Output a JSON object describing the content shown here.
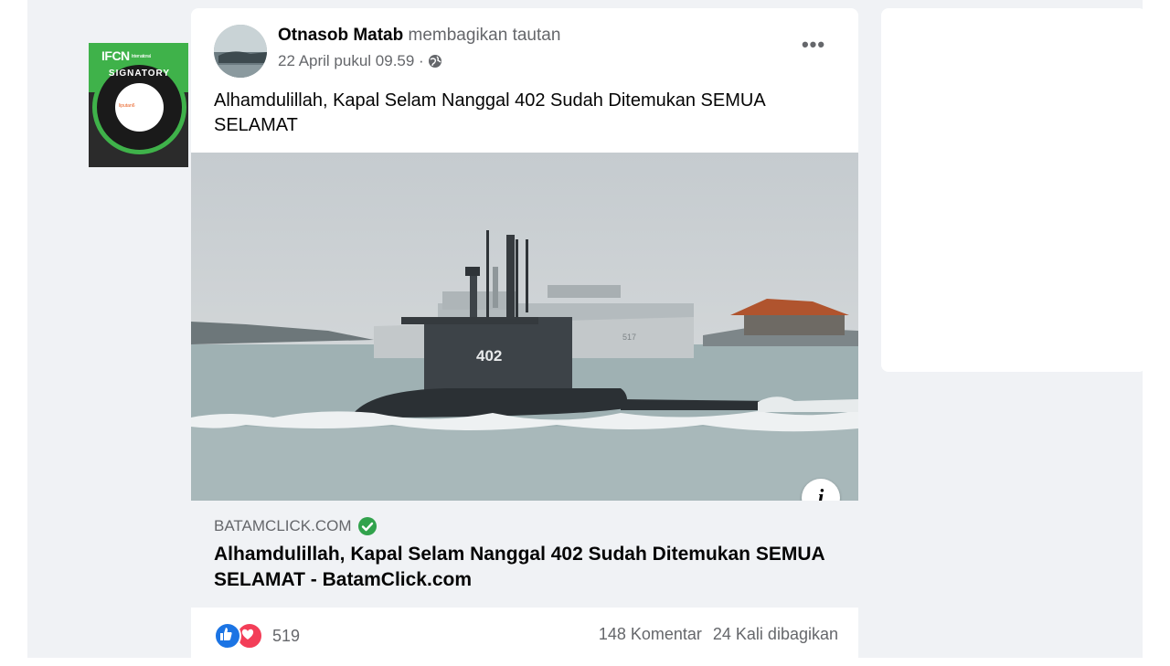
{
  "badge": {
    "top": "IFCN",
    "top_small": "International",
    "ring": "SIGNATORY",
    "inner": "liputan6"
  },
  "post": {
    "author": "Otnasob Matab",
    "action": "membagikan tautan",
    "timestamp": "22 April pukul 09.59 ·",
    "privacy_icon": "globe-icon",
    "more_label": "•••",
    "caption": "Alhamdulillah, Kapal Selam Nanggal 402 Sudah Ditemukan SEMUA SELAMAT",
    "image": {
      "hull_number": "402",
      "ship_number": "517"
    },
    "info_label": "i",
    "link": {
      "domain": "BATAMCLICK.COM",
      "title": "Alhamdulillah, Kapal Selam Nanggal 402 Sudah Ditemukan SEMUA SELAMAT - BatamClick.com"
    },
    "reactions": {
      "types": [
        "like",
        "love"
      ],
      "count": "519"
    },
    "comments": "148 Komentar",
    "shares": "24 Kali dibagikan"
  },
  "colors": {
    "page_bg": "#f0f2f5",
    "link_bg": "#f0f2f5",
    "like": "#1b74e4",
    "love": "#f33e58",
    "verified": "#31a24c",
    "ifcn_green": "#3fb24a"
  }
}
